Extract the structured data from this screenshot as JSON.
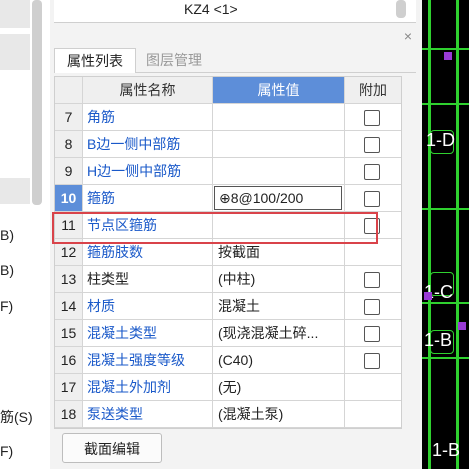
{
  "left_sidebar": {
    "items": [
      "B)",
      "B)",
      "F)",
      "筋(S)",
      "F)"
    ]
  },
  "panel": {
    "top_title": "KZ4 <1>",
    "close_icon": "close-icon",
    "tabs": [
      {
        "label": "属性列表",
        "active": true
      },
      {
        "label": "图层管理",
        "active": false
      }
    ],
    "table": {
      "headers": {
        "name": "属性名称",
        "value": "属性值",
        "extra": "附加"
      },
      "rows": [
        {
          "num": "7",
          "name": "角筋",
          "value": "",
          "checkbox": true,
          "name_color": "blue"
        },
        {
          "num": "8",
          "name": "B边一侧中部筋",
          "value": "",
          "checkbox": true,
          "name_color": "blue"
        },
        {
          "num": "9",
          "name": "H边一侧中部筋",
          "value": "",
          "checkbox": true,
          "name_color": "blue"
        },
        {
          "num": "10",
          "name": "箍筋",
          "value": "⊕8@100/200",
          "checkbox": true,
          "name_color": "blue",
          "selected": true,
          "editing": true
        },
        {
          "num": "11",
          "name": "节点区箍筋",
          "value": "",
          "checkbox": true,
          "name_color": "blue",
          "highlighted": true
        },
        {
          "num": "12",
          "name": "箍筋肢数",
          "value": "按截面",
          "checkbox": false,
          "name_color": "blue"
        },
        {
          "num": "13",
          "name": "柱类型",
          "value": "(中柱)",
          "checkbox": true,
          "name_color": "dark"
        },
        {
          "num": "14",
          "name": "材质",
          "value": "混凝土",
          "checkbox": true,
          "name_color": "blue"
        },
        {
          "num": "15",
          "name": "混凝土类型",
          "value": "(现浇混凝土碎...",
          "checkbox": true,
          "name_color": "blue"
        },
        {
          "num": "16",
          "name": "混凝土强度等级",
          "value": "(C40)",
          "checkbox": true,
          "name_color": "blue"
        },
        {
          "num": "17",
          "name": "混凝土外加剂",
          "value": "(无)",
          "checkbox": false,
          "name_color": "blue"
        },
        {
          "num": "18",
          "name": "泵送类型",
          "value": "(混凝土泵)",
          "checkbox": false,
          "name_color": "blue"
        }
      ]
    },
    "bottom_button": "截面编辑"
  },
  "cad": {
    "labels": [
      "1-D",
      "1-C",
      "1-B",
      "1-B"
    ]
  },
  "colors": {
    "accent": "#5d8ed9",
    "highlight_border": "#d9434a",
    "link_text": "#1a59c9",
    "cad_line": "#2fd12f"
  }
}
